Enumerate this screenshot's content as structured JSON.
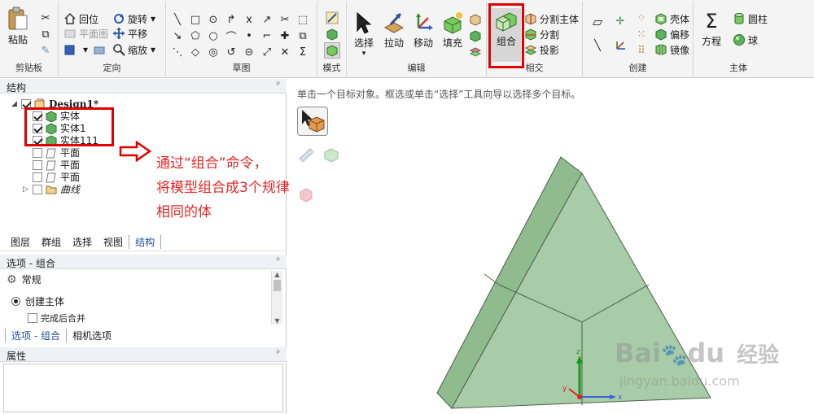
{
  "ribbon": {
    "clipboard": {
      "label": "剪贴板",
      "paste": "粘贴"
    },
    "orient": {
      "label": "定向",
      "home": "回位",
      "plan_view": "平面图",
      "rotate": "旋转",
      "pan": "平移",
      "zoom": "缩放"
    },
    "sketch": {
      "label": "草图"
    },
    "mode": {
      "label": "模式"
    },
    "edit": {
      "label": "编辑",
      "select": "选择",
      "pull": "拉动",
      "move": "移动",
      "fill": "填充"
    },
    "intersect": {
      "label": "相交",
      "combine": "组合",
      "split_body": "分割主体",
      "split": "分割",
      "project": "投影"
    },
    "create": {
      "label": "创建",
      "shell": "壳体",
      "offset": "偏移",
      "mirror": "镜像"
    },
    "body": {
      "label": "主体",
      "equation": "方程",
      "cylinder": "圆柱",
      "sphere": "球"
    }
  },
  "structure": {
    "title": "结构",
    "root": "Design1*",
    "items": [
      {
        "label": "实体",
        "checked": true,
        "type": "solid"
      },
      {
        "label": "实体1",
        "checked": true,
        "type": "solid"
      },
      {
        "label": "实体111",
        "checked": true,
        "type": "solid"
      },
      {
        "label": "平面",
        "checked": false,
        "type": "plane"
      },
      {
        "label": "平面",
        "checked": false,
        "type": "plane"
      },
      {
        "label": "平面",
        "checked": false,
        "type": "plane"
      },
      {
        "label": "曲线",
        "checked": false,
        "type": "folder"
      }
    ]
  },
  "panel_tabs": [
    "图层",
    "群组",
    "选择",
    "视图",
    "结构"
  ],
  "options": {
    "title": "选项 - 组合",
    "section": "常规",
    "create_body": "创建主体",
    "merge_when_done": "完成后合并",
    "tabs": [
      "选项 - 组合",
      "相机选项"
    ]
  },
  "properties": {
    "title": "属性"
  },
  "viewport": {
    "hint": "单击一个目标对象。框选或单击“选择”工具向导以选择多个目标。",
    "axis_x": "x",
    "axis_y": "y",
    "axis_z": "z"
  },
  "annotation": {
    "line1": "通过“组合”命令，",
    "line2": "将模型组合成3个规律",
    "line3": "相同的体"
  },
  "watermark": {
    "brand": "Bai",
    "brand2": "du",
    "cn": "经验",
    "url": "jingyan.baidu.com"
  },
  "colors": {
    "accent": "#1f4e9c",
    "highlight": "#e00000",
    "annotation": "#e32626",
    "model_face": "#a8cca8",
    "model_side": "#8fbb8f",
    "model_edge": "#4b5f4b"
  }
}
